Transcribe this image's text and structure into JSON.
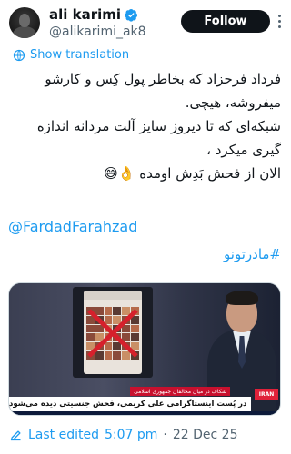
{
  "author": {
    "display_name": "ali karimi",
    "handle": "@alikarimi_ak8",
    "verified": true
  },
  "actions": {
    "follow_label": "Follow",
    "more_icon": "more-dots-icon"
  },
  "translation": {
    "label": "Show translation",
    "icon": "globe-icon"
  },
  "tweet": {
    "lines": [
      "فرداد فرحزاد که بخاطر پول کِس و کارشو",
      "میفروشه، هیچی.",
      "شبکه‌ای که تا دیروز  سایز آلت مردانه  اندازه",
      "گیری میکرد ،",
      "الان از فحش بَدِش اومده 👌😅"
    ],
    "mention": "@FardadFarahzad",
    "hashtag": "#مادرتونو"
  },
  "media": {
    "strap_small": "شکاف در میان مخالفان جمهوری اسلامی",
    "strap_main": "در پُست اینستاگرامی علی کریمی، فحش جنسیتی دیده می‌شود",
    "channel_logo": "IRAN"
  },
  "footer": {
    "edited_label": "Last edited",
    "time": "5:07 pm",
    "separator": "·",
    "date": "22 Dec 25"
  },
  "colors": {
    "accent": "#1d9bf0",
    "text": "#0f1419",
    "muted": "#536471",
    "follow_bg": "#0f1419"
  }
}
